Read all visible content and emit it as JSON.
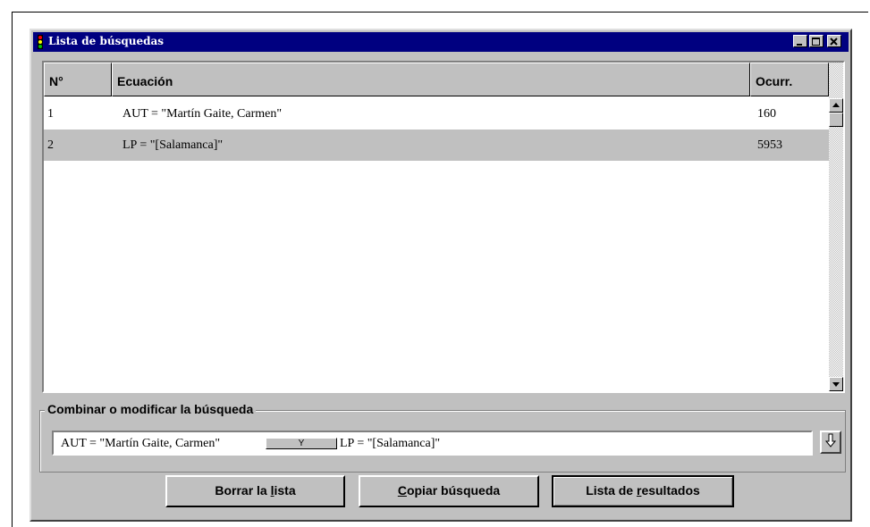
{
  "window": {
    "title": "Lista de búsquedas",
    "title_icon": "traffic-light-icon"
  },
  "table": {
    "headers": {
      "num": "N°",
      "equation": "Ecuación",
      "occurrences": "Ocurr."
    },
    "rows": [
      {
        "num": "1",
        "equation": "AUT = \"Martín Gaite, Carmen\"",
        "occurrences": "160"
      },
      {
        "num": "2",
        "equation": "LP = \"[Salamanca]\"",
        "occurrences": "5953"
      }
    ],
    "selected_row": 2
  },
  "combine": {
    "label": "Combinar o modificar la búsqueda",
    "left": "AUT = \"Martín Gaite, Carmen\"",
    "operator": "Y",
    "right": "LP = \"[Salamanca]\"",
    "apply_icon": "down-arrow-icon"
  },
  "buttons": {
    "clear_pre": "Borrar la ",
    "clear_key": "l",
    "clear_post": "ista",
    "copy_pre": "",
    "copy_key": "C",
    "copy_post": "opiar búsqueda",
    "results_pre": "Lista de ",
    "results_key": "r",
    "results_post": "esultados"
  },
  "colors": {
    "titlebar": "#000080",
    "face": "#c0c0c0",
    "selection": "#c0c0c0"
  }
}
